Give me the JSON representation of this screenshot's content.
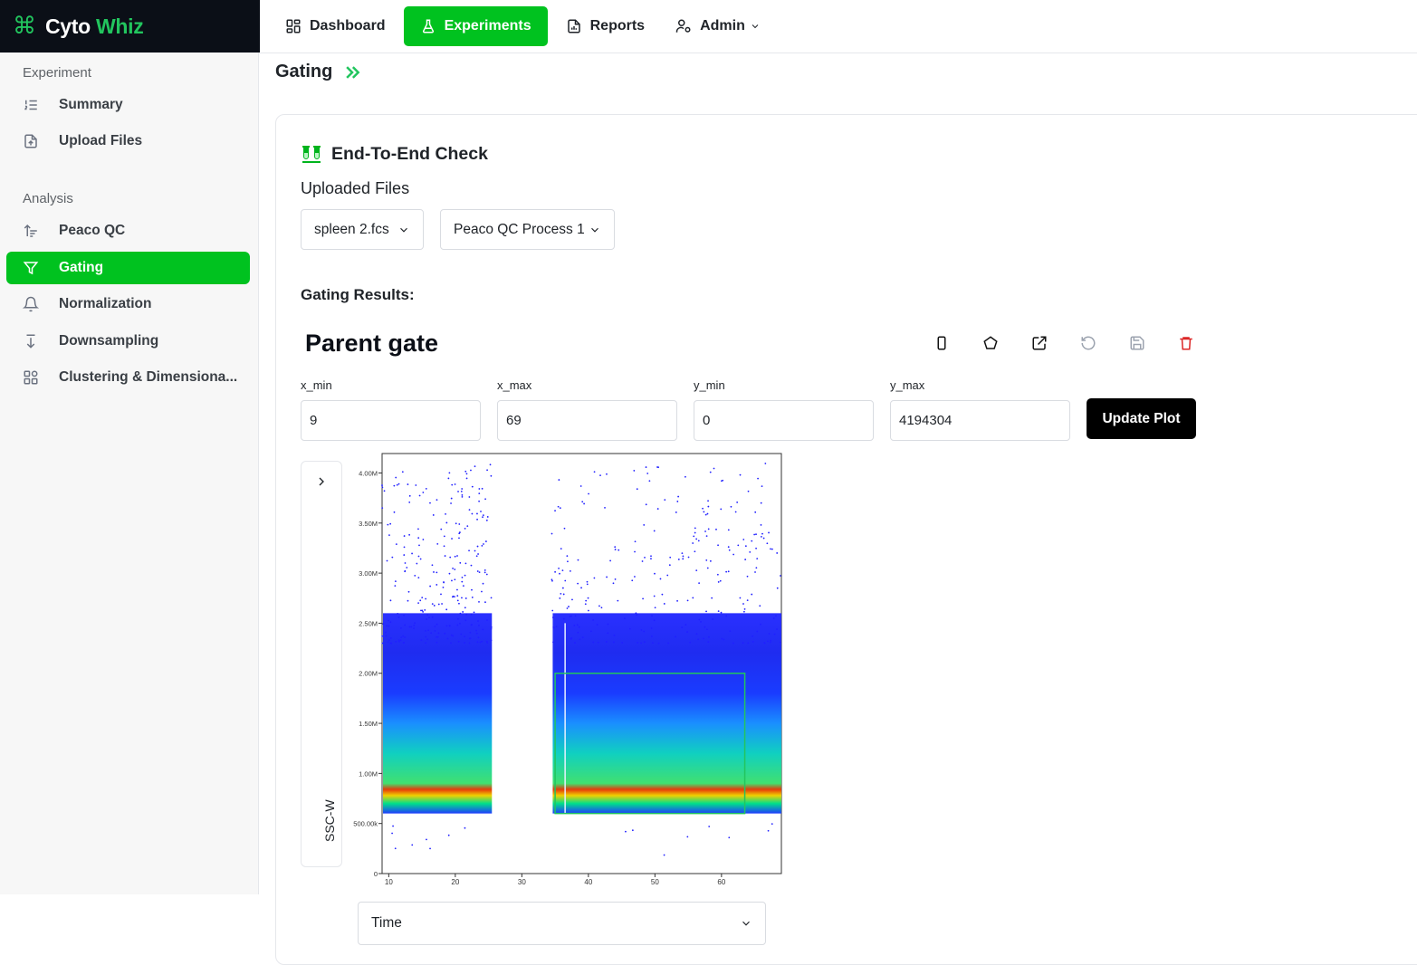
{
  "brand": {
    "name_first": "Cyto",
    "name_second": "Whiz",
    "accent": "#22c55e"
  },
  "topnav": {
    "dashboard": "Dashboard",
    "experiments": "Experiments",
    "reports": "Reports",
    "admin": "Admin"
  },
  "sidebar": {
    "experiment_label": "Experiment",
    "summary": "Summary",
    "upload_files": "Upload Files",
    "analysis_label": "Analysis",
    "peaco_qc": "Peaco QC",
    "gating": "Gating",
    "normalization": "Normalization",
    "downsampling": "Downsampling",
    "clustering": "Clustering & Dimensiona..."
  },
  "breadcrumb": {
    "title": "Gating"
  },
  "experiment": {
    "title": "End-To-End Check",
    "uploaded_label": "Uploaded Files",
    "file_select": "spleen 2.fcs",
    "process_select": "Peaco QC Process 1"
  },
  "gating": {
    "results_label": "Gating Results:",
    "gate_title": "Parent gate",
    "x_min_label": "x_min",
    "x_max_label": "x_max",
    "y_min_label": "y_min",
    "y_max_label": "y_max",
    "x_min": "9",
    "x_max": "69",
    "y_min": "0",
    "y_max": "4194304",
    "update_button": "Update Plot",
    "y_axis_channel": "SSC-W",
    "x_axis_channel": "Time"
  },
  "colors": {
    "primary": "#00c21f",
    "delete": "#dc2626",
    "gate_outline": "#22c55e"
  },
  "chart_data": {
    "type": "scatter",
    "title": "",
    "xlabel": "Time",
    "ylabel": "SSC-W",
    "xlim": [
      9,
      69
    ],
    "ylim": [
      0,
      4194304
    ],
    "x_ticks": [
      10,
      20,
      30,
      40,
      50,
      60
    ],
    "x_tick_labels": [
      "10",
      "20",
      "30",
      "40",
      "50",
      "60"
    ],
    "y_ticks": [
      0,
      500000,
      1000000,
      1500000,
      2000000,
      2500000,
      3000000,
      3500000,
      4000000
    ],
    "y_tick_labels": [
      "0",
      "500.00k",
      "1.00M",
      "1.50M",
      "2.00M",
      "2.50M",
      "3.00M",
      "3.50M",
      "4.00M"
    ],
    "density_colormap": [
      "blue",
      "cyan",
      "green",
      "yellow",
      "red"
    ],
    "event_clusters": [
      {
        "x_range": [
          9,
          25.5
        ],
        "y_baseline": 600000,
        "dense_band_y": 700000
      },
      {
        "x_range": [
          34.5,
          69
        ],
        "y_baseline": 600000,
        "dense_band_y": 700000
      }
    ],
    "gate": {
      "shape": "rectangle",
      "x": [
        35,
        63.5
      ],
      "y": [
        600000,
        2000000
      ]
    },
    "grid": false
  }
}
